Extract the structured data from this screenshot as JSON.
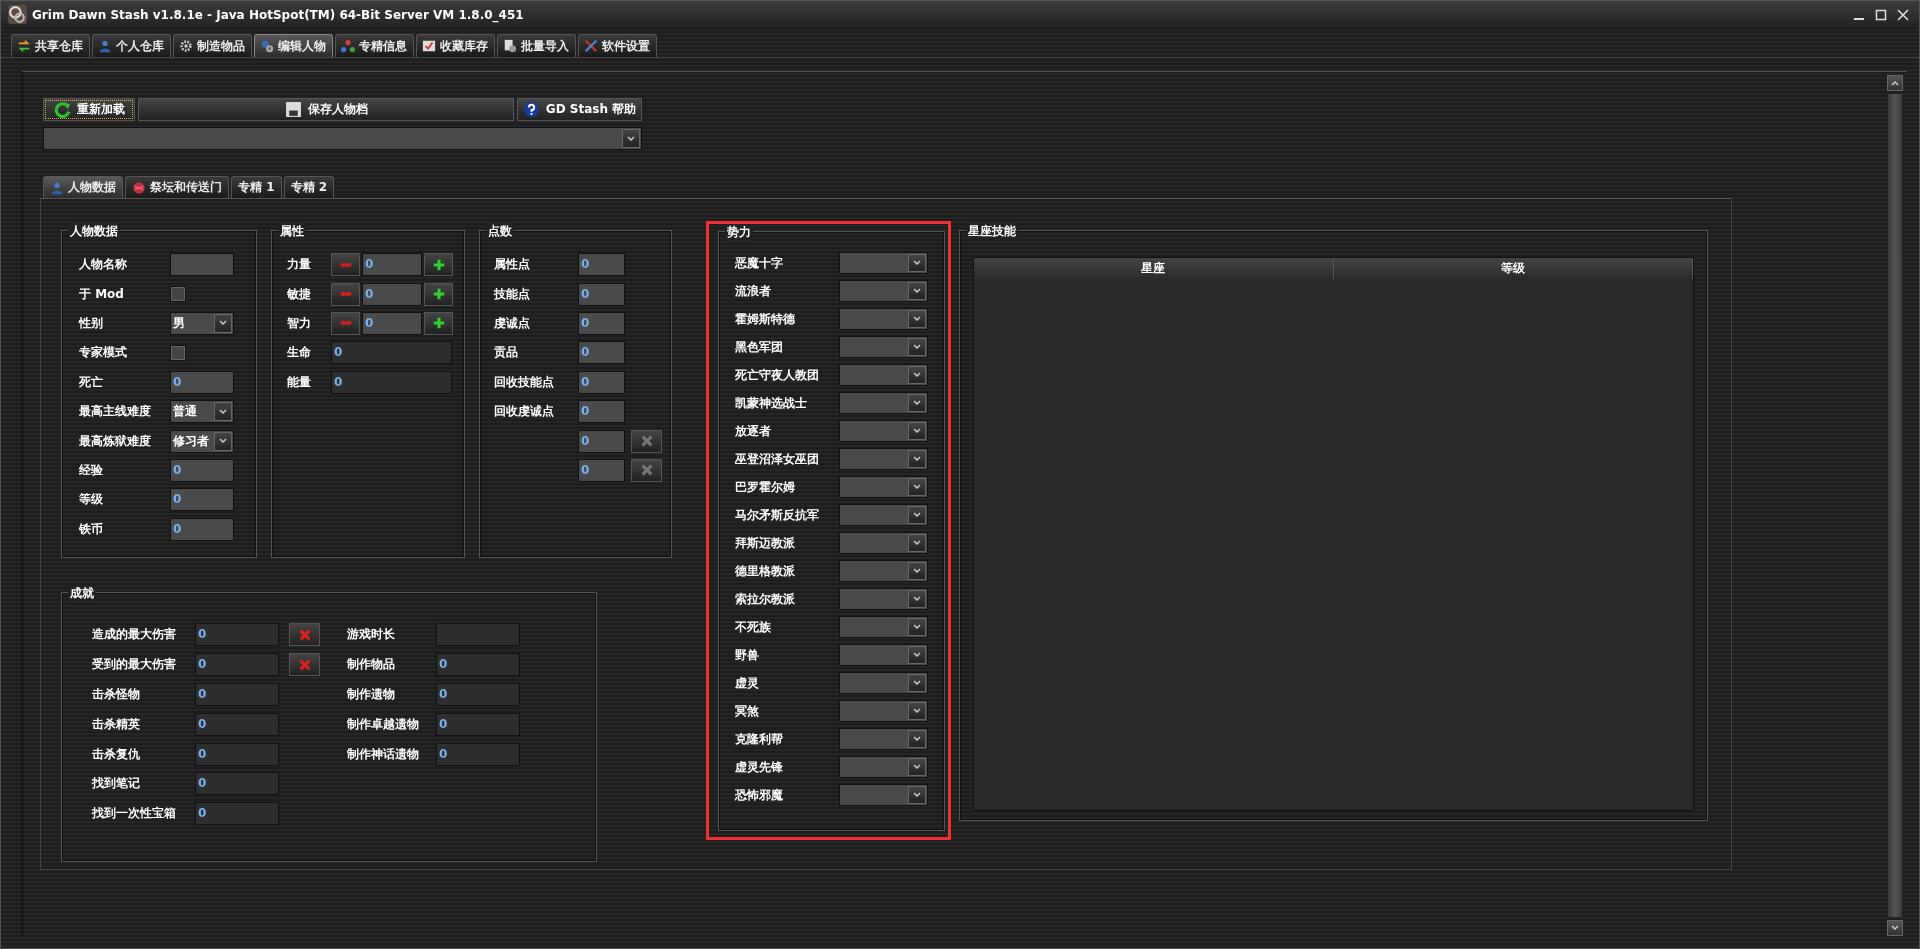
{
  "window": {
    "title": "Grim Dawn Stash v1.8.1e - Java HotSpot(TM) 64-Bit Server VM 1.8.0_451"
  },
  "tabs": [
    {
      "label": "共享仓库",
      "selected": false
    },
    {
      "label": "个人仓库",
      "selected": false
    },
    {
      "label": "制造物品",
      "selected": false
    },
    {
      "label": "编辑人物",
      "selected": true
    },
    {
      "label": "专精信息",
      "selected": false
    },
    {
      "label": "收藏库存",
      "selected": false
    },
    {
      "label": "批量导入",
      "selected": false
    },
    {
      "label": "软件设置",
      "selected": false
    }
  ],
  "toolbar": [
    {
      "label": "重新加载",
      "focused": true
    },
    {
      "label": "保存人物档",
      "focused": false
    },
    {
      "label": "GD Stash 帮助",
      "focused": false
    }
  ],
  "subtabs": [
    {
      "label": "人物数据",
      "selected": true
    },
    {
      "label": "祭坛和传送门",
      "selected": false
    },
    {
      "label": "专精 1",
      "selected": false
    },
    {
      "label": "专精 2",
      "selected": false
    }
  ],
  "character_data": {
    "title": "人物数据",
    "fields": [
      {
        "label": "人物名称",
        "kind": "text"
      },
      {
        "label": "于 Mod",
        "kind": "checkbox",
        "checked": false
      },
      {
        "label": "性别",
        "kind": "combo",
        "value": "男"
      },
      {
        "label": "专家模式",
        "kind": "checkbox",
        "checked": false
      },
      {
        "label": "死亡",
        "kind": "text",
        "value": "0"
      },
      {
        "label": "最高主线难度",
        "kind": "combo",
        "value": "普通"
      },
      {
        "label": "最高炼狱难度",
        "kind": "combo",
        "value": "修习者"
      },
      {
        "label": "经验",
        "kind": "text",
        "value": "0"
      },
      {
        "label": "等级",
        "kind": "text",
        "value": "0"
      },
      {
        "label": "铁币",
        "kind": "text",
        "value": "0"
      }
    ]
  },
  "attributes": {
    "title": "属性",
    "fields": [
      {
        "label": "力量",
        "kind": "stepper",
        "value": "0"
      },
      {
        "label": "敏捷",
        "kind": "stepper",
        "value": "0"
      },
      {
        "label": "智力",
        "kind": "stepper",
        "value": "0"
      },
      {
        "label": "生命",
        "kind": "text",
        "value": "0"
      },
      {
        "label": "能量",
        "kind": "text",
        "value": "0"
      }
    ]
  },
  "points": {
    "title": "点数",
    "fields": [
      {
        "label": "属性点",
        "kind": "text",
        "value": "0"
      },
      {
        "label": "技能点",
        "kind": "text",
        "value": "0"
      },
      {
        "label": "虔诚点",
        "kind": "text",
        "value": "0"
      },
      {
        "label": "贡品",
        "kind": "text",
        "value": "0"
      },
      {
        "label": "回收技能点",
        "kind": "text",
        "value": "0"
      },
      {
        "label": "回收虔诚点",
        "kind": "text",
        "value": "0"
      },
      {
        "kind": "clearable",
        "value": "0"
      },
      {
        "kind": "clearable",
        "value": "0"
      }
    ]
  },
  "achievements": {
    "title": "成就",
    "left": [
      {
        "label": "造成的最大伤害",
        "value": "0",
        "clear": true
      },
      {
        "label": "受到的最大伤害",
        "value": "0",
        "clear": true
      },
      {
        "label": "击杀怪物",
        "value": "0",
        "clear": false
      },
      {
        "label": "击杀精英",
        "value": "0",
        "clear": false
      },
      {
        "label": "击杀复仇",
        "value": "0",
        "clear": false
      },
      {
        "label": "找到笔记",
        "value": "0",
        "clear": false
      },
      {
        "label": "找到一次性宝箱",
        "value": "0",
        "clear": false
      }
    ],
    "right": [
      {
        "label": "游戏时长"
      },
      {
        "label": "制作物品",
        "value": "0"
      },
      {
        "label": "制作遗物",
        "value": "0"
      },
      {
        "label": "制作卓越遗物",
        "value": "0"
      },
      {
        "label": "制作神话遗物",
        "value": "0"
      }
    ]
  },
  "factions": {
    "title": "势力",
    "highlighted": true,
    "items": [
      {
        "label": "恶魔十字"
      },
      {
        "label": "流浪者"
      },
      {
        "label": "霍姆斯特德"
      },
      {
        "label": "黑色军团"
      },
      {
        "label": "死亡守夜人教团"
      },
      {
        "label": "凯蒙神选战士"
      },
      {
        "label": "放逐者"
      },
      {
        "label": "巫登沼泽女巫团"
      },
      {
        "label": "巴罗霍尔姆"
      },
      {
        "label": "马尔矛斯反抗军"
      },
      {
        "label": "拜斯迈教派"
      },
      {
        "label": "德里格教派"
      },
      {
        "label": "索拉尔教派"
      },
      {
        "label": "不死族"
      },
      {
        "label": "野兽"
      },
      {
        "label": "虚灵"
      },
      {
        "label": "冥煞"
      },
      {
        "label": "克隆利帮"
      },
      {
        "label": "虚灵先锋"
      },
      {
        "label": "恐怖邪魔"
      }
    ]
  },
  "constellations": {
    "title": "星座技能",
    "columns": [
      "星座",
      "等级"
    ]
  }
}
